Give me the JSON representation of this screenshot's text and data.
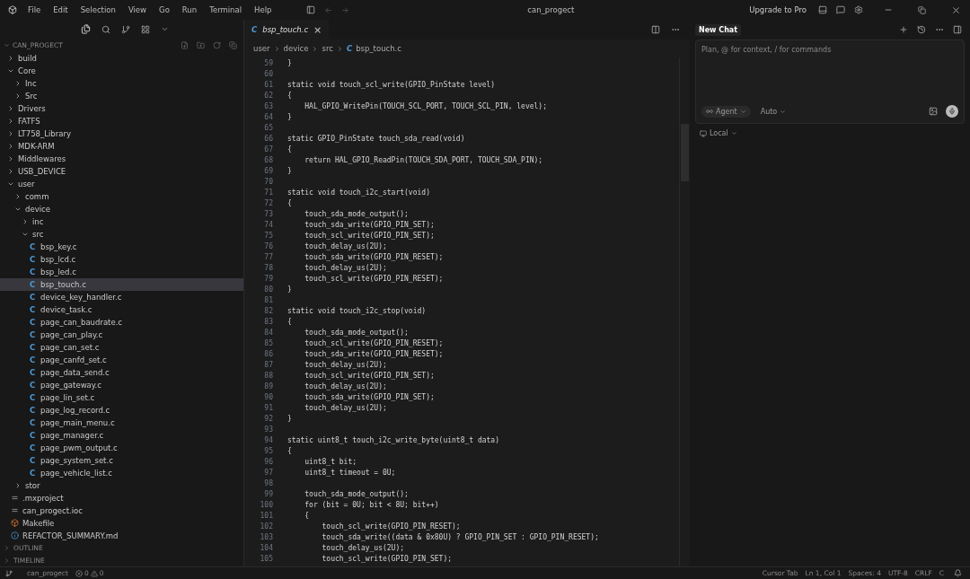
{
  "title_bar": {
    "menus": [
      "File",
      "Edit",
      "Selection",
      "View",
      "Go",
      "Run",
      "Terminal",
      "Help"
    ],
    "title": "can_progect",
    "upgrade": "Upgrade to Pro"
  },
  "sidebar": {
    "header": "CAN_PROGECT",
    "items": [
      {
        "label": "build",
        "kind": "folder",
        "expanded": false,
        "selected": false
      },
      {
        "label": "Core",
        "kind": "folder",
        "expanded": true,
        "selected": false,
        "children": [
          {
            "label": "Inc",
            "kind": "folder",
            "expanded": false,
            "selected": false
          },
          {
            "label": "Src",
            "kind": "folder",
            "expanded": false,
            "selected": false
          }
        ]
      },
      {
        "label": "Drivers",
        "kind": "folder",
        "expanded": false,
        "selected": false
      },
      {
        "label": "FATFS",
        "kind": "folder",
        "expanded": false,
        "selected": false
      },
      {
        "label": "LT758_Library",
        "kind": "folder",
        "expanded": false,
        "selected": false
      },
      {
        "label": "MDK-ARM",
        "kind": "folder",
        "expanded": false,
        "selected": false
      },
      {
        "label": "Middlewares",
        "kind": "folder",
        "expanded": false,
        "selected": false
      },
      {
        "label": "USB_DEVICE",
        "kind": "folder",
        "expanded": false,
        "selected": false
      },
      {
        "label": "user",
        "kind": "folder",
        "expanded": true,
        "selected": false,
        "children": [
          {
            "label": "comm",
            "kind": "folder",
            "expanded": false,
            "selected": false
          },
          {
            "label": "device",
            "kind": "folder",
            "expanded": true,
            "selected": false,
            "children": [
              {
                "label": "inc",
                "kind": "folder",
                "expanded": false,
                "selected": false
              },
              {
                "label": "src",
                "kind": "folder",
                "expanded": true,
                "selected": false,
                "children": [
                  {
                    "label": "bsp_key.c",
                    "kind": "c",
                    "icon": "C",
                    "selected": false
                  },
                  {
                    "label": "bsp_lcd.c",
                    "kind": "c",
                    "icon": "C",
                    "selected": false
                  },
                  {
                    "label": "bsp_led.c",
                    "kind": "c",
                    "icon": "C",
                    "selected": false
                  },
                  {
                    "label": "bsp_touch.c",
                    "kind": "c",
                    "icon": "C",
                    "selected": true
                  },
                  {
                    "label": "device_key_handler.c",
                    "kind": "c",
                    "icon": "C",
                    "selected": false
                  },
                  {
                    "label": "device_task.c",
                    "kind": "c",
                    "icon": "C",
                    "selected": false
                  },
                  {
                    "label": "page_can_baudrate.c",
                    "kind": "c",
                    "icon": "C",
                    "selected": false
                  },
                  {
                    "label": "page_can_play.c",
                    "kind": "c",
                    "icon": "C",
                    "selected": false
                  },
                  {
                    "label": "page_can_set.c",
                    "kind": "c",
                    "icon": "C",
                    "selected": false
                  },
                  {
                    "label": "page_canfd_set.c",
                    "kind": "c",
                    "icon": "C",
                    "selected": false
                  },
                  {
                    "label": "page_data_send.c",
                    "kind": "c",
                    "icon": "C",
                    "selected": false
                  },
                  {
                    "label": "page_gateway.c",
                    "kind": "c",
                    "icon": "C",
                    "selected": false
                  },
                  {
                    "label": "page_lin_set.c",
                    "kind": "c",
                    "icon": "C",
                    "selected": false
                  },
                  {
                    "label": "page_log_record.c",
                    "kind": "c",
                    "icon": "C",
                    "selected": false
                  },
                  {
                    "label": "page_main_menu.c",
                    "kind": "c",
                    "icon": "C",
                    "selected": false
                  },
                  {
                    "label": "page_manager.c",
                    "kind": "c",
                    "icon": "C",
                    "selected": false
                  },
                  {
                    "label": "page_pwm_output.c",
                    "kind": "c",
                    "icon": "C",
                    "selected": false
                  },
                  {
                    "label": "page_system_set.c",
                    "kind": "c",
                    "icon": "C",
                    "selected": false
                  },
                  {
                    "label": "page_vehicle_list.c",
                    "kind": "c",
                    "icon": "C",
                    "selected": false
                  }
                ]
              }
            ]
          },
          {
            "label": "stor",
            "kind": "folder",
            "expanded": false,
            "selected": false
          }
        ]
      },
      {
        "label": ".mxproject",
        "kind": "config",
        "selected": false
      },
      {
        "label": "can_progect.ioc",
        "kind": "config",
        "selected": false
      },
      {
        "label": "Makefile",
        "kind": "makefile",
        "selected": false
      },
      {
        "label": "REFACTOR_SUMMARY.md",
        "kind": "markdown",
        "selected": false
      }
    ],
    "sections": [
      "OUTLINE",
      "TIMELINE"
    ]
  },
  "editor": {
    "tab": {
      "icon": "C",
      "label": "bsp_touch.c",
      "close": "×"
    },
    "breadcrumb": [
      "user",
      "device",
      "src",
      "bsp_touch.c"
    ],
    "breadcrumb_icon": "C",
    "lines": [
      {
        "n": "59",
        "t": "}"
      },
      {
        "n": "60"
      },
      {
        "n": "61",
        "t": "static void touch_scl_write(GPIO_PinState level)"
      },
      {
        "n": "62",
        "t": "{"
      },
      {
        "n": "63",
        "t": "    HAL_GPIO_WritePin(TOUCH_SCL_PORT, TOUCH_SCL_PIN, level);"
      },
      {
        "n": "64",
        "t": "}"
      },
      {
        "n": "65"
      },
      {
        "n": "66",
        "t": "static GPIO_PinState touch_sda_read(void)"
      },
      {
        "n": "67",
        "t": "{"
      },
      {
        "n": "68",
        "t": "    return HAL_GPIO_ReadPin(TOUCH_SDA_PORT, TOUCH_SDA_PIN);"
      },
      {
        "n": "69",
        "t": "}"
      },
      {
        "n": "70"
      },
      {
        "n": "71",
        "t": "static void touch_i2c_start(void)"
      },
      {
        "n": "72",
        "t": "{"
      },
      {
        "n": "73",
        "t": "    touch_sda_mode_output();"
      },
      {
        "n": "74",
        "t": "    touch_sda_write(GPIO_PIN_SET);"
      },
      {
        "n": "75",
        "t": "    touch_scl_write(GPIO_PIN_SET);"
      },
      {
        "n": "76",
        "t": "    touch_delay_us(2U);"
      },
      {
        "n": "77",
        "t": "    touch_sda_write(GPIO_PIN_RESET);"
      },
      {
        "n": "78",
        "t": "    touch_delay_us(2U);"
      },
      {
        "n": "79",
        "t": "    touch_scl_write(GPIO_PIN_RESET);"
      },
      {
        "n": "80",
        "t": "}"
      },
      {
        "n": "81"
      },
      {
        "n": "82",
        "t": "static void touch_i2c_stop(void)"
      },
      {
        "n": "83",
        "t": "{"
      },
      {
        "n": "84",
        "t": "    touch_sda_mode_output();"
      },
      {
        "n": "85",
        "t": "    touch_scl_write(GPIO_PIN_RESET);"
      },
      {
        "n": "86",
        "t": "    touch_sda_write(GPIO_PIN_RESET);"
      },
      {
        "n": "87",
        "t": "    touch_delay_us(2U);"
      },
      {
        "n": "88",
        "t": "    touch_scl_write(GPIO_PIN_SET);"
      },
      {
        "n": "89",
        "t": "    touch_delay_us(2U);"
      },
      {
        "n": "90",
        "t": "    touch_sda_write(GPIO_PIN_SET);"
      },
      {
        "n": "91",
        "t": "    touch_delay_us(2U);"
      },
      {
        "n": "92",
        "t": "}"
      },
      {
        "n": "93"
      },
      {
        "n": "94",
        "t": "static uint8_t touch_i2c_write_byte(uint8_t data)"
      },
      {
        "n": "95",
        "t": "{"
      },
      {
        "n": "96",
        "t": "    uint8_t bit;"
      },
      {
        "n": "97",
        "t": "    uint8_t timeout = 0U;"
      },
      {
        "n": "98"
      },
      {
        "n": "99",
        "t": "    touch_sda_mode_output();"
      },
      {
        "n": "100",
        "t": "    for (bit = 0U; bit < 8U; bit++)"
      },
      {
        "n": "101",
        "t": "    {"
      },
      {
        "n": "102",
        "t": "        touch_scl_write(GPIO_PIN_RESET);"
      },
      {
        "n": "103",
        "t": "        touch_sda_write((data & 0x80U) ? GPIO_PIN_SET : GPIO_PIN_RESET);"
      },
      {
        "n": "104",
        "t": "        touch_delay_us(2U);"
      },
      {
        "n": "105",
        "t": "        touch_scl_write(GPIO_PIN_SET);"
      }
    ]
  },
  "chat": {
    "tab": "New Chat",
    "placeholder": "Plan, @ for context, / for commands",
    "mode": "Agent",
    "model": "Auto",
    "location": "Local"
  },
  "status_bar": {
    "branch": "can_progect",
    "errors": "0",
    "warnings": "0",
    "right": [
      "Cursor Tab",
      "Ln 1, Col 1",
      "Spaces: 4",
      "UTF-8",
      "CRLF",
      "C"
    ]
  }
}
